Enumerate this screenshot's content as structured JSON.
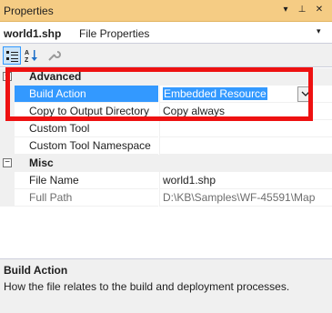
{
  "window": {
    "title": "Properties",
    "dropdown_glyph": "▾",
    "pin_glyph": "⊥",
    "close_glyph": "✕"
  },
  "object": {
    "name": "world1.shp",
    "type": "File Properties"
  },
  "toolbar": {
    "categorized_icon": "categorized-icon",
    "alphabetical_icon": "alphabetical-icon",
    "property_pages_icon": "wrench-icon"
  },
  "categories": [
    {
      "name": "Advanced",
      "collapse_glyph": "−",
      "properties": [
        {
          "name": "Build Action",
          "value": "Embedded Resource"
        },
        {
          "name": "Copy to Output Directory",
          "value": "Copy always"
        },
        {
          "name": "Custom Tool",
          "value": ""
        },
        {
          "name": "Custom Tool Namespace",
          "value": ""
        }
      ]
    },
    {
      "name": "Misc",
      "collapse_glyph": "−",
      "properties": [
        {
          "name": "File Name",
          "value": "world1.shp"
        },
        {
          "name": "Full Path",
          "value": "D:\\KB\\Samples\\WF-45591\\Map"
        }
      ]
    }
  ],
  "description": {
    "title": "Build Action",
    "text": "How the file relates to the build and deployment processes."
  },
  "colors": {
    "title_bar": "#f5cc84",
    "selection": "#3399ff",
    "highlight_box": "#ee1111"
  }
}
